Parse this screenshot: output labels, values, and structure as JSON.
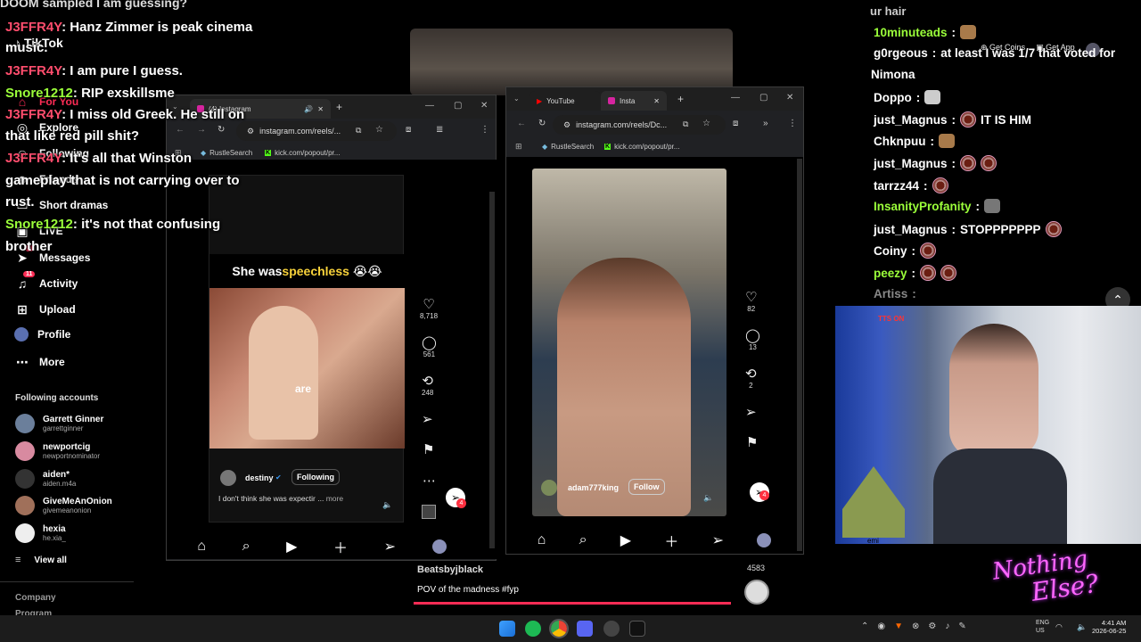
{
  "top_overlay": {
    "doom_text": "DOOM sampled I am guessing?",
    "ur_hair": "ur hair"
  },
  "tiktok": {
    "logo": "TikTok",
    "for_you": "For You",
    "nav": [
      {
        "label": "Explore",
        "icon": "compass-icon"
      },
      {
        "label": "Following",
        "icon": "users-icon"
      },
      {
        "label": "Friends",
        "icon": "friends-icon"
      },
      {
        "label": "Short dramas",
        "icon": "tv-icon"
      },
      {
        "label": "LIVE",
        "icon": "live-icon"
      },
      {
        "label": "Messages",
        "icon": "send-icon",
        "badge": "5"
      },
      {
        "label": "Activity",
        "icon": "bell-icon",
        "badge": "11"
      },
      {
        "label": "Upload",
        "icon": "plus-square-icon"
      },
      {
        "label": "Profile",
        "icon": "avatar-icon"
      },
      {
        "label": "More",
        "icon": "ellipsis-icon"
      }
    ],
    "following_heading": "Following accounts",
    "accounts": [
      {
        "name": "Garrett Ginner",
        "handle": "garrettginner",
        "color": "#6b7f9b"
      },
      {
        "name": "newportcig",
        "handle": "newportnominator",
        "color": "#d88aa0"
      },
      {
        "name": "aiden*",
        "handle": "aiden.m4a",
        "color": "#333"
      },
      {
        "name": "GiveMeAnOnion",
        "handle": "givemeanonion",
        "color": "#a0705a"
      },
      {
        "name": "hexia",
        "handle": "he.xia_",
        "color": "#eee"
      }
    ],
    "view_all": "View all",
    "footer": [
      "Company",
      "Program"
    ]
  },
  "chat_left": [
    {
      "user": "J3FFR4Y",
      "text": "Hanz Zimmer is peak cinema",
      "wrap": "music.",
      "color": "red"
    },
    {
      "user": "J3FFR4Y",
      "text": "I am pure I guess.",
      "color": "red"
    },
    {
      "user": "Snore1212",
      "text": "RIP exskillsme",
      "color": "green"
    },
    {
      "user": "J3FFR4Y",
      "text": "I miss old Greek. He still on",
      "wrap": "that like red pill shit?",
      "color": "red"
    },
    {
      "user": "J3FFR4Y",
      "text": "It's all that Winston",
      "wrap": "gameplay that is not carrying over to",
      "wrap2": "rust.",
      "color": "red"
    },
    {
      "user": "Snore1212",
      "text": "it's not that confusing",
      "wrap": "brother",
      "color": "green"
    }
  ],
  "win1": {
    "tab": "(4) Instagram",
    "url": "instagram.com/reels/...",
    "bookmarks": [
      "RustleSearch",
      "kick.com/popout/pr..."
    ],
    "caption_a": "She was ",
    "caption_b": "speechless",
    "caption_emoji": "😭😭",
    "subtitle": "are",
    "likes": "8,718",
    "comments": "561",
    "reposts": "248",
    "user": "destiny",
    "following": "Following",
    "desc": "I don't think she was expectir ...",
    "more": "more",
    "badge": "4"
  },
  "win2": {
    "tabs": [
      "YouTube",
      "Insta"
    ],
    "url": "instagram.com/reels/Dc...",
    "bookmarks": [
      "RustleSearch",
      "kick.com/popout/pr..."
    ],
    "likes": "82",
    "comments": "13",
    "reposts": "2",
    "user": "adam777king",
    "follow": "Follow",
    "badge": "4"
  },
  "tiktok_video": {
    "user": "Beatsbyjblack",
    "caption": "POV of the madness #fyp",
    "count": "4583"
  },
  "chat_right": [
    {
      "user": "10minuteads",
      "text": "",
      "ucolor": "#9bff3a",
      "emote": "cat"
    },
    {
      "user": "g0rgeous",
      "text": "at least I was 1/7 that voted for",
      "ucolor": "#fff"
    },
    {
      "user": "",
      "text": "Nimona",
      "ucolor": "#fff",
      "cont": true
    },
    {
      "user": "Doppo",
      "text": "",
      "ucolor": "#fff",
      "emote": "face"
    },
    {
      "user": "just_Magnus",
      "text": "IT IS HIM",
      "ucolor": "#fff",
      "emote": "cookie"
    },
    {
      "user": "Chknpuu",
      "text": "",
      "ucolor": "#fff",
      "emote": "cat"
    },
    {
      "user": "just_Magnus",
      "text": "",
      "ucolor": "#fff",
      "emote": "cookie2"
    },
    {
      "user": "tarrzz44",
      "text": "",
      "ucolor": "#fff",
      "emote": "cookie"
    },
    {
      "user": "InsanityProfanity",
      "text": "",
      "ucolor": "#9bff3a",
      "emote": "face"
    },
    {
      "user": "just_Magnus",
      "text": "STOPPPPPPP",
      "ucolor": "#fff",
      "emote": "cookie"
    },
    {
      "user": "Coiny",
      "text": "",
      "ucolor": "#fff",
      "emote": "cookie"
    },
    {
      "user": "peezy",
      "text": "",
      "ucolor": "#9bff3a",
      "emote": "cookie2"
    },
    {
      "user": "Artiss",
      "text": "",
      "ucolor": "#888"
    }
  ],
  "top_right": {
    "coins": "Get Coins",
    "app": "Get App"
  },
  "webcam": {
    "overlay_text": "TTS ON",
    "gnome_name": "emi"
  },
  "brand": {
    "line1": "Nothing",
    "line2": "Else?"
  },
  "taskbar": {
    "lang": "ENG",
    "region": "US",
    "time": "4:41 AM",
    "date": "2026-06-25"
  }
}
